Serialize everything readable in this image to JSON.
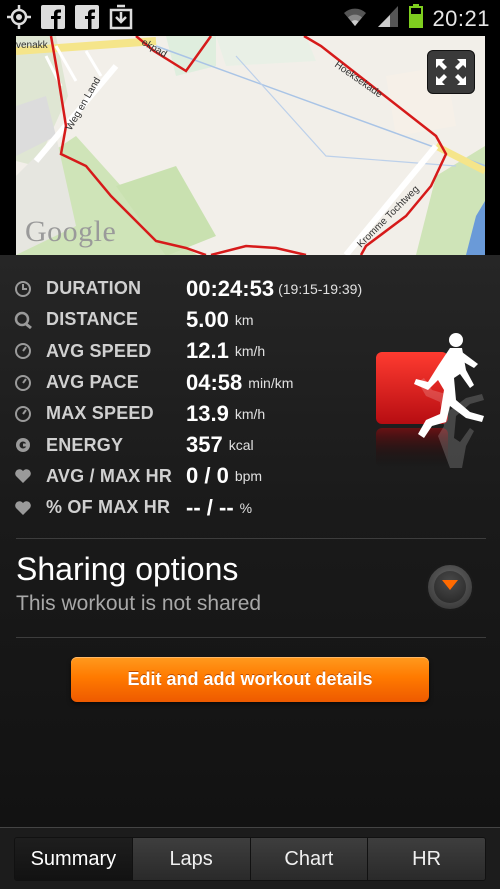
{
  "status_bar": {
    "time": "20:21",
    "icons": [
      "gps-icon",
      "facebook-icon",
      "facebook-icon",
      "download-icon",
      "wifi-icon",
      "signal-icon",
      "battery-icon"
    ]
  },
  "map": {
    "attribution": "Google",
    "street_labels": [
      "Weg en Land",
      "Hoeksekade",
      "Kromme Tochtweg",
      "venakk",
      "ekpad"
    ],
    "fullscreen_icon": "expand-arrows-icon"
  },
  "stats": [
    {
      "label": "DURATION",
      "value": "00:24:53",
      "unit": "",
      "sub": "(19:15-19:39)",
      "icon": "clock-icon"
    },
    {
      "label": "DISTANCE",
      "value": "5.00",
      "unit": "km",
      "sub": "",
      "icon": "distance-icon"
    },
    {
      "label": "AVG SPEED",
      "value": "12.1",
      "unit": "km/h",
      "sub": "",
      "icon": "gauge-icon"
    },
    {
      "label": "AVG PACE",
      "value": "04:58",
      "unit": "min/km",
      "sub": "",
      "icon": "gauge-icon"
    },
    {
      "label": "MAX SPEED",
      "value": "13.9",
      "unit": "km/h",
      "sub": "",
      "icon": "gauge-icon"
    },
    {
      "label": "ENERGY",
      "value": "357",
      "unit": "kcal",
      "sub": "",
      "icon": "energy-icon"
    },
    {
      "label": "AVG / MAX HR",
      "value": "0 / 0",
      "unit": "bpm",
      "sub": "",
      "icon": "heart-icon"
    },
    {
      "label": "% OF MAX HR",
      "value": "-- / --",
      "unit": "%",
      "sub": "",
      "icon": "heart-icon"
    }
  ],
  "sharing": {
    "title": "Sharing options",
    "subtitle": "This workout is not shared"
  },
  "edit_button": "Edit and add workout details",
  "tabs": [
    {
      "label": "Summary",
      "active": true
    },
    {
      "label": "Laps",
      "active": false
    },
    {
      "label": "Chart",
      "active": false
    },
    {
      "label": "HR",
      "active": false
    }
  ],
  "colors": {
    "accent_orange": "#ff7a00",
    "route_red": "#d61a1a",
    "sport_icon_red": "#e31e24"
  }
}
